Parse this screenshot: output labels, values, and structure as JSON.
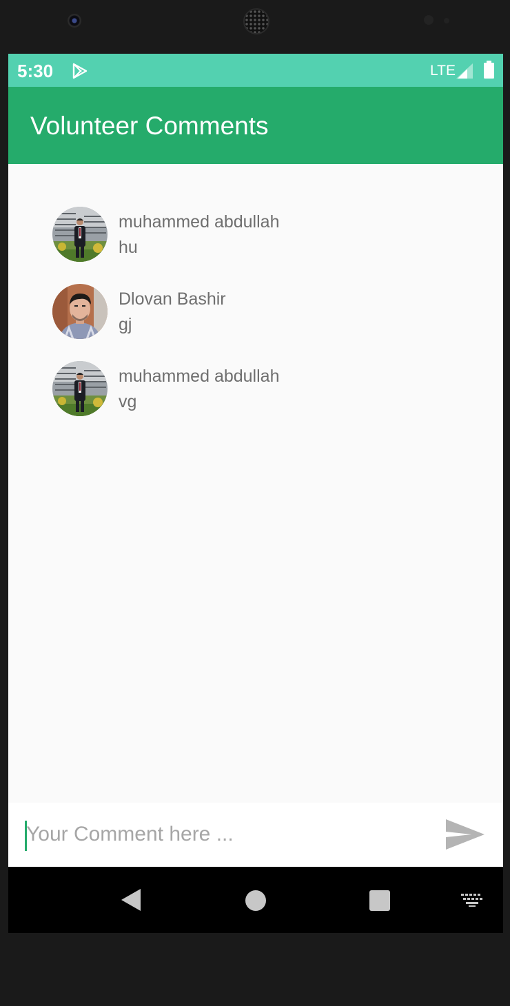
{
  "status_bar": {
    "time": "5:30",
    "network": "LTE",
    "icons": [
      "play-store-icon",
      "signal-icon",
      "battery-icon"
    ]
  },
  "app_bar": {
    "title": "Volunteer Comments",
    "color": "#25ab6b"
  },
  "comments": [
    {
      "name": "muhammed abdullah",
      "text": "hu",
      "avatar": "avatar-photo"
    },
    {
      "name": "Dlovan Bashir",
      "text": "gj",
      "avatar": "avatar-photo"
    },
    {
      "name": "muhammed abdullah",
      "text": "vg",
      "avatar": "avatar-photo"
    }
  ],
  "comment_input": {
    "value": "",
    "placeholder": "Your Comment here ...",
    "send_icon": "send-icon"
  },
  "nav_bar": {
    "icons": [
      "back-icon",
      "home-icon",
      "recents-icon",
      "keyboard-icon"
    ]
  },
  "colors": {
    "status_bar": "#53d1b0",
    "app_bar": "#25ab6b",
    "background": "#fafafa",
    "text_secondary": "#6f6f6f"
  }
}
